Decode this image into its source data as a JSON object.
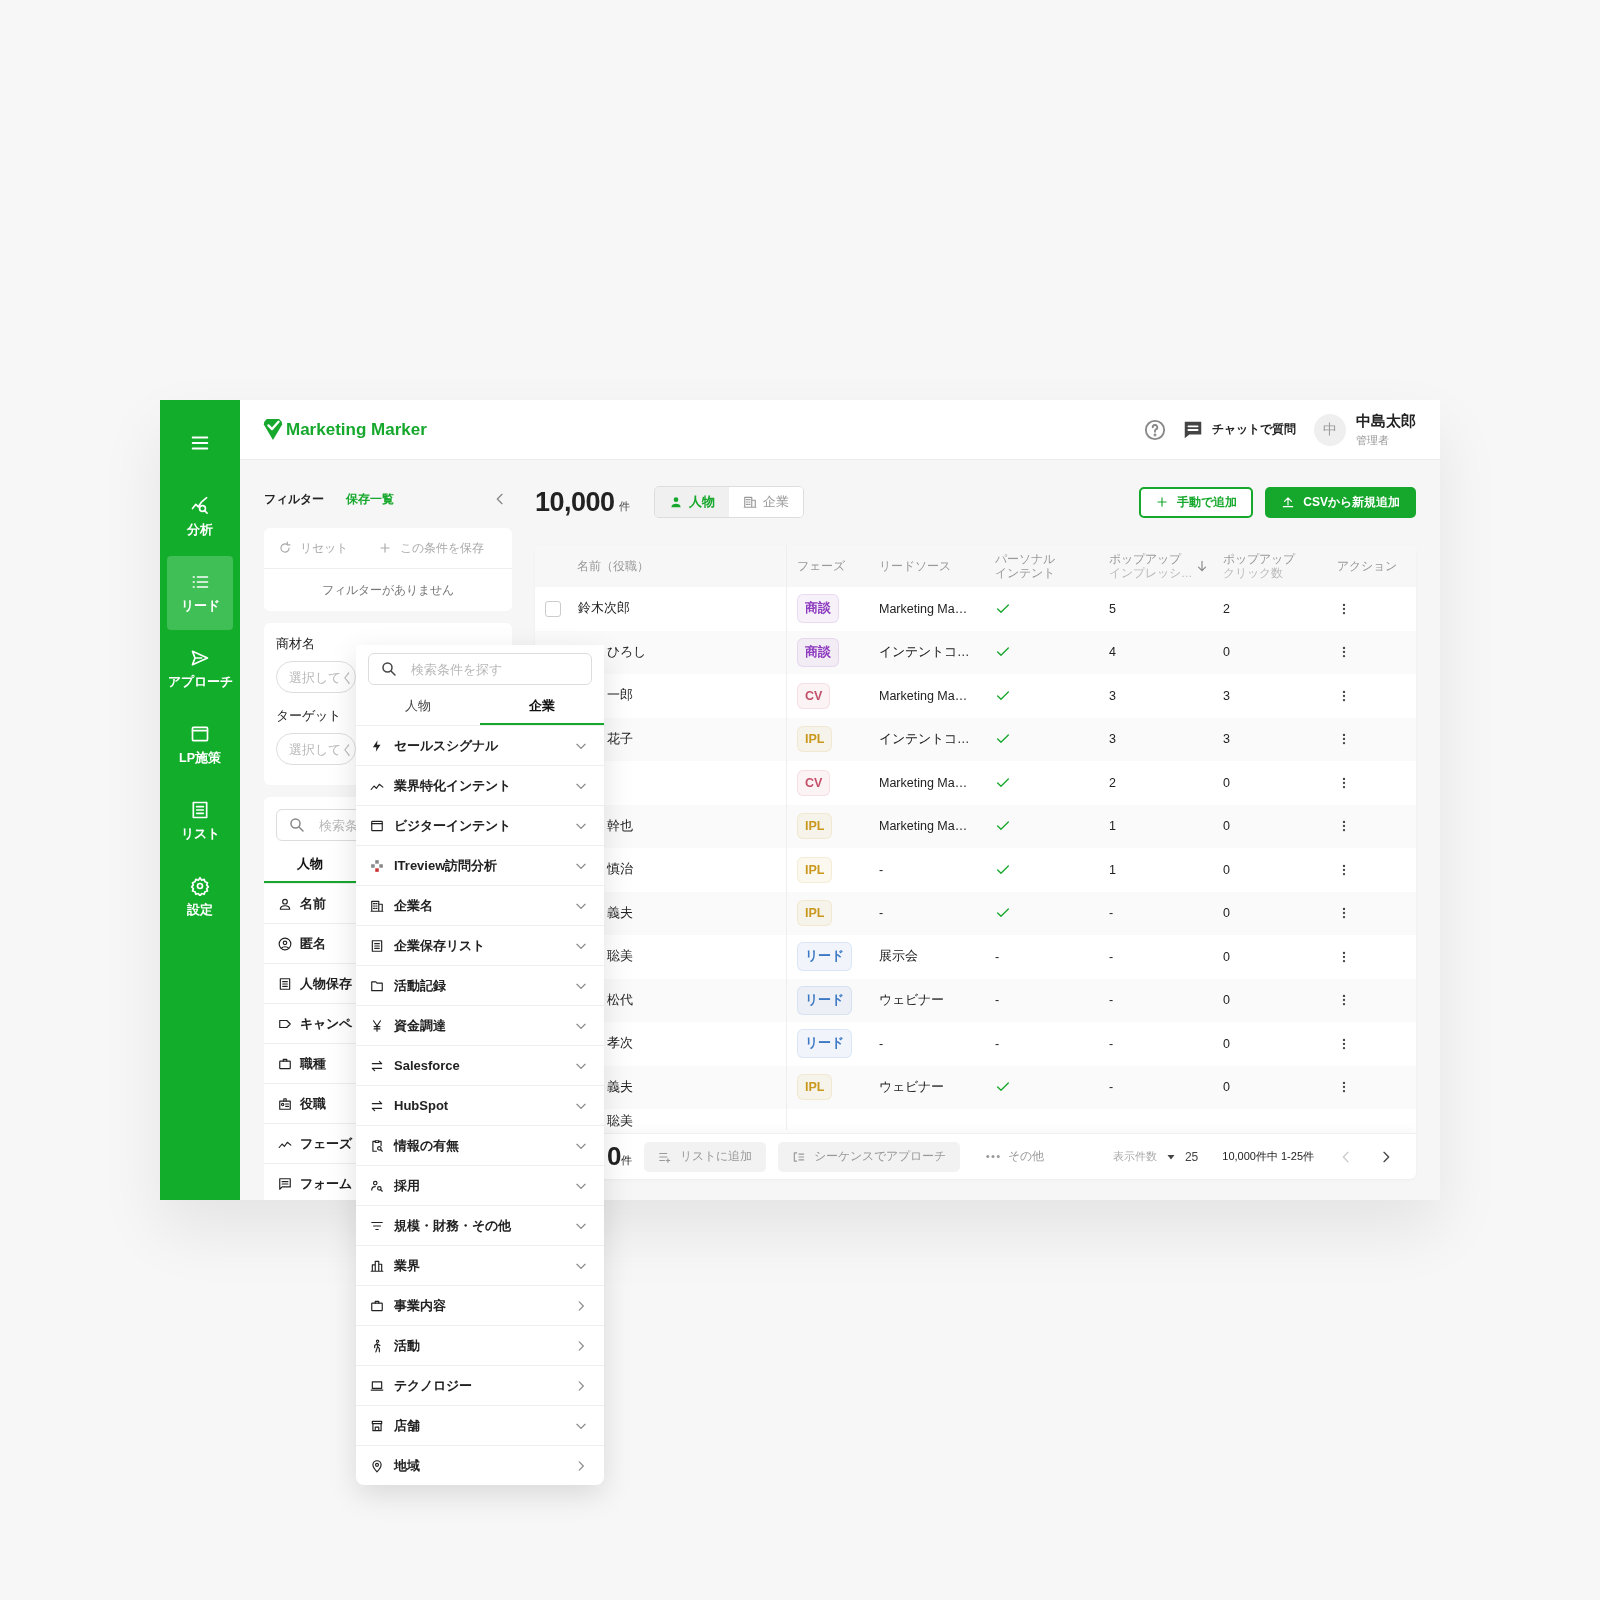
{
  "sidebar": {
    "items": [
      {
        "label": "分析",
        "selected": false
      },
      {
        "label": "リード",
        "selected": true
      },
      {
        "label": "アプローチ",
        "selected": false
      },
      {
        "label": "LP施策",
        "selected": false
      },
      {
        "label": "リスト",
        "selected": false
      },
      {
        "label": "設定",
        "selected": false
      }
    ]
  },
  "header": {
    "logo": "Marketing Marker",
    "chat": "チャットで質問",
    "avatar": "中",
    "user_name": "中島太郎",
    "user_role": "管理者"
  },
  "filter": {
    "title": "フィルター",
    "saved_link": "保存一覧",
    "reset": "リセット",
    "save": "この条件を保存",
    "empty": "フィルターがありません",
    "fields": [
      {
        "label": "商材名",
        "placeholder": "選択してく"
      },
      {
        "label": "ターゲット",
        "placeholder": "選択してく"
      }
    ],
    "search": {
      "placeholder": "検索条"
    },
    "tabs": [
      {
        "label": "人物",
        "selected": true
      }
    ],
    "items": [
      "名前",
      "匿名",
      "人物保存",
      "キャンペ",
      "職種",
      "役職",
      "フェーズ",
      "フォーム"
    ]
  },
  "summary": {
    "count": "10,000",
    "unit": "件",
    "segments": [
      {
        "label": "人物",
        "selected": true
      },
      {
        "label": "企業",
        "selected": false
      }
    ],
    "manual_add": "手動で追加",
    "csv_add": "CSVから新規追加"
  },
  "table": {
    "columns": [
      {
        "label": "名前（役職）"
      },
      {
        "label": "フェーズ"
      },
      {
        "label": "リードソース"
      },
      {
        "label": "パーソナル",
        "label_2": "インテント"
      },
      {
        "label": "ポップアップ",
        "sub": "インプレッシ…",
        "sorted": true
      },
      {
        "label": "ポップアップ",
        "sub": "クリック数"
      },
      {
        "label": "アクション"
      }
    ],
    "rows": [
      {
        "checked": false,
        "name": "鈴木次郎",
        "phase": {
          "label": "商談",
          "color": "#8e3cbf"
        },
        "source": "Marketing Ma…",
        "intent_checked": true,
        "impressions": "5",
        "clicks": "2"
      },
      {
        "name": "ひろし",
        "phase": {
          "label": "商談",
          "color": "#8e3cbf"
        },
        "source": "インテントコ…",
        "intent_checked": true,
        "impressions": "4",
        "clicks": "0"
      },
      {
        "name": "一郎",
        "phase": {
          "label": "CV",
          "color": "#c4506a"
        },
        "source": "Marketing Ma…",
        "intent_checked": true,
        "impressions": "3",
        "clicks": "3"
      },
      {
        "name": "花子",
        "phase": {
          "label": "IPL",
          "color": "#c9981c"
        },
        "source": "インテントコ…",
        "intent_checked": true,
        "impressions": "3",
        "clicks": "3"
      },
      {
        "phase": {
          "label": "CV",
          "color": "#c4506a"
        },
        "source": "Marketing Ma…",
        "intent_checked": true,
        "impressions": "2",
        "clicks": "0"
      },
      {
        "name": "幹也",
        "phase": {
          "label": "IPL",
          "color": "#c9981c"
        },
        "source": "Marketing Ma…",
        "intent_checked": true,
        "impressions": "1",
        "clicks": "0"
      },
      {
        "name": "慎治",
        "phase": {
          "label": "IPL",
          "color": "#c9981c"
        },
        "source": "-",
        "intent_checked": true,
        "impressions": "1",
        "clicks": "0"
      },
      {
        "name": "義夫",
        "phase": {
          "label": "IPL",
          "color": "#c9981c"
        },
        "source": "-",
        "intent_checked": true,
        "impressions": "-",
        "clicks": "0"
      },
      {
        "name": "聡美",
        "phase": {
          "label": "リード",
          "color": "#3b78c4"
        },
        "source": "展示会",
        "intent_checked": false,
        "intent": "-",
        "impressions": "-",
        "clicks": "0"
      },
      {
        "name": "松代",
        "phase": {
          "label": "リード",
          "color": "#3b78c4"
        },
        "source": "ウェビナー",
        "intent_checked": false,
        "intent": "-",
        "impressions": "-",
        "clicks": "0"
      },
      {
        "name": "孝次",
        "phase": {
          "label": "リード",
          "color": "#3b78c4"
        },
        "source": "-",
        "intent_checked": false,
        "intent": "-",
        "impressions": "-",
        "clicks": "0"
      },
      {
        "name": "義夫",
        "phase": {
          "label": "IPL",
          "color": "#c9981c"
        },
        "source": "ウェビナー",
        "intent_checked": true,
        "impressions": "-",
        "clicks": "0"
      },
      {
        "name": "聡美"
      }
    ]
  },
  "footer": {
    "count": "0",
    "unit": "件",
    "add_to_list": "リストに追加",
    "sequence": "シーケンスでアプローチ",
    "more": "その他",
    "per_page_label": "表示件数",
    "per_page": "25",
    "range": "10,000件中 1-25件",
    "prev_disabled": true,
    "next_disabled": false
  },
  "dropdown": {
    "search": {
      "placeholder": "検索条件を探す"
    },
    "tabs": [
      {
        "label": "人物",
        "selected": false
      },
      {
        "label": "企業",
        "selected": true
      }
    ],
    "items": [
      {
        "label": "セールスシグナル",
        "kind": "accordion"
      },
      {
        "label": "業界特化インテント",
        "kind": "accordion"
      },
      {
        "label": "ビジターインテント",
        "kind": "accordion"
      },
      {
        "label": "ITreview訪問分析",
        "kind": "accordion"
      },
      {
        "label": "企業名",
        "kind": "accordion"
      },
      {
        "label": "企業保存リスト",
        "kind": "accordion"
      },
      {
        "label": "活動記録",
        "kind": "accordion"
      },
      {
        "label": "資金調達",
        "kind": "accordion"
      },
      {
        "label": "Salesforce",
        "kind": "accordion"
      },
      {
        "label": "HubSpot",
        "kind": "accordion"
      },
      {
        "label": "情報の有無",
        "kind": "accordion"
      },
      {
        "label": "採用",
        "kind": "accordion"
      },
      {
        "label": "規模・財務・その他",
        "kind": "accordion"
      },
      {
        "label": "業界",
        "kind": "accordion"
      },
      {
        "label": "事業内容",
        "kind": "submenu"
      },
      {
        "label": "活動",
        "kind": "submenu"
      },
      {
        "label": "テクノロジー",
        "kind": "submenu"
      },
      {
        "label": "店舗",
        "kind": "accordion"
      },
      {
        "label": "地域",
        "kind": "submenu"
      }
    ]
  }
}
